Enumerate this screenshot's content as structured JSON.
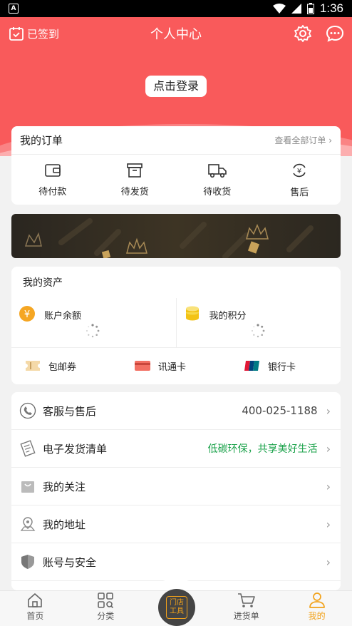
{
  "header": {
    "signed_label": "已签到",
    "title": "个人中心",
    "login_label": "点击登录"
  },
  "orders": {
    "title": "我的订单",
    "view_all": "查看全部订单",
    "items": [
      {
        "label": "待付款",
        "icon": "wallet-icon"
      },
      {
        "label": "待发货",
        "icon": "box-icon"
      },
      {
        "label": "待收货",
        "icon": "truck-icon"
      },
      {
        "label": "售后",
        "icon": "yen-refund-icon"
      }
    ]
  },
  "assets": {
    "title": "我的资产",
    "balance_label": "账户余额",
    "points_label": "我的积分",
    "cards": [
      {
        "label": "包邮券",
        "icon": "coupon-icon"
      },
      {
        "label": "讯通卡",
        "icon": "card-icon"
      },
      {
        "label": "银行卡",
        "icon": "unionpay-icon"
      }
    ]
  },
  "list": {
    "items": [
      {
        "label": "客服与售后",
        "value": "400-025-1188",
        "icon": "phone-icon"
      },
      {
        "label": "电子发货清单",
        "value": "低碳环保，共享美好生活",
        "icon": "receipt-icon"
      },
      {
        "label": "我的关注",
        "value": "",
        "icon": "bag-icon"
      },
      {
        "label": "我的地址",
        "value": "",
        "icon": "location-icon"
      },
      {
        "label": "账号与安全",
        "value": "",
        "icon": "shield-icon"
      }
    ]
  },
  "nav": {
    "items": [
      {
        "label": "首页",
        "icon": "home-icon"
      },
      {
        "label": "分类",
        "icon": "category-icon"
      },
      {
        "label": "进货单",
        "icon": "cart-icon"
      },
      {
        "label": "我的",
        "icon": "profile-icon"
      }
    ],
    "center_label": "门店工具"
  },
  "status": {
    "time": "1:36"
  },
  "colors": {
    "primary": "#f95a5b",
    "accent": "#f2a21a",
    "green": "#1aa24a"
  }
}
